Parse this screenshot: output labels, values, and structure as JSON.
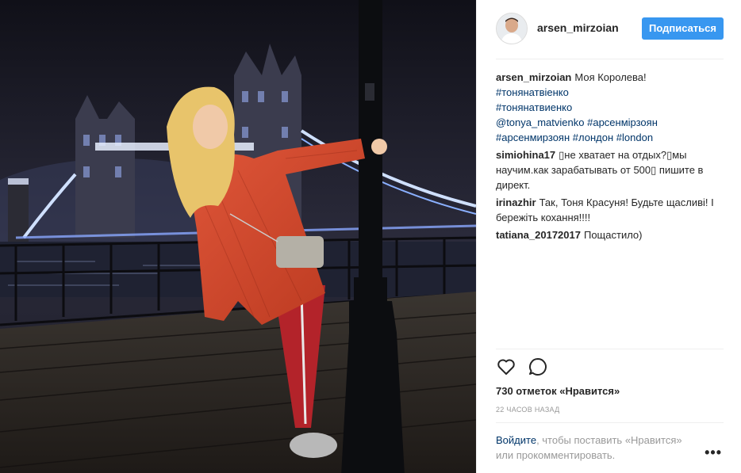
{
  "post": {
    "username": "arsen_mirzoian",
    "follow_label": "Подписаться",
    "caption_user": "arsen_mirzoian",
    "caption_text": "Моя Королева!",
    "caption_tags": [
      "#тонянатвiенко",
      "#тонянатвиенко",
      "@tonya_matvienko",
      "#арсенмiрзоян",
      "#арсенмирзоян",
      "#лондон",
      "#london"
    ],
    "comments": [
      {
        "user": "simiohina17",
        "text": "▯не хватает на отдых?▯мы научим.как зарабатывать от 500▯ пишите в директ."
      },
      {
        "user": "irinazhir",
        "text": "Так, Тоня Красуня! Будьте щасливі! І бережіть кохання!!!!"
      },
      {
        "user": "tatiana_20172017",
        "text": "Пощастило)"
      }
    ],
    "likes_text": "730 отметок «Нравится»",
    "time_text": "22 часов назад",
    "login_link": "Войдите",
    "login_text": ", чтобы поставить «Нравится» или прокомментировать.",
    "more_label": "•••"
  },
  "icons": {
    "like": "heart-icon",
    "comment": "comment-bubble-icon",
    "more": "more-options-icon"
  },
  "colors": {
    "accent": "#3897f0",
    "link": "#003569",
    "muted": "#999999",
    "text": "#262626"
  }
}
